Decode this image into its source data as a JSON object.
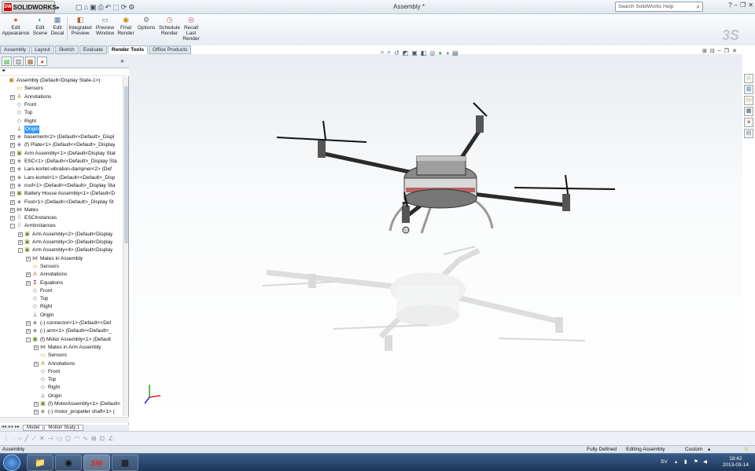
{
  "app": {
    "brand": "SOLIDWORKS",
    "document_title": "Assembly *",
    "search_placeholder": "Search SolidWorks Help"
  },
  "ribbon": {
    "buttons": [
      {
        "label": "Edit\nAppearance",
        "icon": "sphere-paint-icon"
      },
      {
        "label": "Edit\nScene",
        "icon": "scene-icon"
      },
      {
        "label": "Edit\nDecal",
        "icon": "decal-icon"
      },
      {
        "label": "Integrated\nPreview",
        "icon": "integrated-preview-icon"
      },
      {
        "label": "Preview\nWindow",
        "icon": "preview-window-icon"
      },
      {
        "label": "Final\nRender",
        "icon": "final-render-icon"
      },
      {
        "label": "Options",
        "icon": "options-icon"
      },
      {
        "label": "Schedule\nRender",
        "icon": "schedule-render-icon"
      },
      {
        "label": "Recall\nLast\nRender",
        "icon": "recall-render-icon"
      }
    ]
  },
  "tabs": [
    "Assembly",
    "Layout",
    "Sketch",
    "Evaluate",
    "Render Tools",
    "Office Products"
  ],
  "active_tab": "Render Tools",
  "tree": [
    {
      "label": "Assembly  (Default<Display State-1>)",
      "level": 0,
      "icon": "assembly-icon",
      "exp": ""
    },
    {
      "label": "Sensors",
      "level": 1,
      "icon": "folder-icon",
      "exp": ""
    },
    {
      "label": "Annotations",
      "level": 1,
      "icon": "annotation-icon",
      "exp": "+"
    },
    {
      "label": "Front",
      "level": 1,
      "icon": "plane-icon",
      "exp": ""
    },
    {
      "label": "Top",
      "level": 1,
      "icon": "plane-icon",
      "exp": ""
    },
    {
      "label": "Right",
      "level": 1,
      "icon": "plane-icon",
      "exp": ""
    },
    {
      "label": "Origin",
      "level": 1,
      "icon": "origin-icon",
      "exp": "",
      "selected": true
    },
    {
      "label": "basement<2> (Default<<Default>_Displ",
      "level": 1,
      "icon": "part-icon",
      "exp": "+"
    },
    {
      "label": "(f) Plate<1> (Default<<Default>_Display",
      "level": 1,
      "icon": "part-icon",
      "exp": "+"
    },
    {
      "label": "Arm Assembly<1> (Default<Display Stat",
      "level": 1,
      "icon": "subassembly-icon",
      "exp": "+"
    },
    {
      "label": "ESC<1> (Default<<Default>_Display Sta",
      "level": 1,
      "icon": "part-icon",
      "exp": "+"
    },
    {
      "label": "Lars-kortet-vibration-dampner<2> (Def",
      "level": 1,
      "icon": "part-icon",
      "exp": "+"
    },
    {
      "label": "Lars-kortet<1> (Default<<Default>_Disp",
      "level": 1,
      "icon": "part-icon",
      "exp": "+"
    },
    {
      "label": "roof<1> (Default<<Default>_Display Sta",
      "level": 1,
      "icon": "part-icon",
      "exp": "+"
    },
    {
      "label": "Battery House Assembly<1> (Default<D",
      "level": 1,
      "icon": "subassembly-icon",
      "exp": "+"
    },
    {
      "label": "Foot<1> (Default<<Default>_Display St",
      "level": 1,
      "icon": "part-icon",
      "exp": "+"
    },
    {
      "label": "Mates",
      "level": 1,
      "icon": "mates-icon",
      "exp": "+"
    },
    {
      "label": "ESCInstances",
      "level": 1,
      "icon": "pattern-icon",
      "exp": "+"
    },
    {
      "label": "ArmInstances",
      "level": 1,
      "icon": "pattern-icon",
      "exp": "-"
    },
    {
      "label": "Arm Assembly<2> (Default<Display",
      "level": 2,
      "icon": "subassembly-icon",
      "exp": "+"
    },
    {
      "label": "Arm Assembly<3> (Default<Display",
      "level": 2,
      "icon": "subassembly-icon",
      "exp": "+"
    },
    {
      "label": "Arm Assembly<4> (Default<Display",
      "level": 2,
      "icon": "subassembly-icon",
      "exp": "-"
    },
    {
      "label": "Mates in Assembly",
      "level": 3,
      "icon": "mates-icon",
      "exp": "+"
    },
    {
      "label": "Sensors",
      "level": 3,
      "icon": "folder-icon",
      "exp": ""
    },
    {
      "label": "Annotations",
      "level": 3,
      "icon": "annotation-icon",
      "exp": "+"
    },
    {
      "label": "Equations",
      "level": 3,
      "icon": "equations-icon",
      "exp": "+"
    },
    {
      "label": "Front",
      "level": 3,
      "icon": "plane-icon",
      "exp": ""
    },
    {
      "label": "Top",
      "level": 3,
      "icon": "plane-icon",
      "exp": ""
    },
    {
      "label": "Right",
      "level": 3,
      "icon": "plane-icon",
      "exp": ""
    },
    {
      "label": "Origin",
      "level": 3,
      "icon": "origin-icon",
      "exp": ""
    },
    {
      "label": "(-) connector<1> (Default<<Def",
      "level": 3,
      "icon": "part-icon",
      "exp": "+"
    },
    {
      "label": "(-) arm<1> (Default<<Default>_",
      "level": 3,
      "icon": "part-icon",
      "exp": "+"
    },
    {
      "label": "(f) Motor Assembly<1> (Default",
      "level": 3,
      "icon": "subassembly-icon",
      "exp": "-"
    },
    {
      "label": "Mates in Arm Assembly",
      "level": 4,
      "icon": "mates-icon",
      "exp": "+"
    },
    {
      "label": "Sensors",
      "level": 4,
      "icon": "folder-icon",
      "exp": ""
    },
    {
      "label": "Annotations",
      "level": 4,
      "icon": "annotation-icon",
      "exp": "+"
    },
    {
      "label": "Front",
      "level": 4,
      "icon": "plane-icon",
      "exp": ""
    },
    {
      "label": "Top",
      "level": 4,
      "icon": "plane-icon",
      "exp": ""
    },
    {
      "label": "Right",
      "level": 4,
      "icon": "plane-icon",
      "exp": ""
    },
    {
      "label": "Origin",
      "level": 4,
      "icon": "origin-icon",
      "exp": ""
    },
    {
      "label": "(f) MotorAssembly<1> (Default<",
      "level": 4,
      "icon": "subassembly-icon",
      "exp": "+"
    },
    {
      "label": "(-) motor_propeller shaft<1> (",
      "level": 4,
      "icon": "part-icon",
      "exp": "+"
    }
  ],
  "bottom_tabs": [
    "Model",
    "Motion Study 1"
  ],
  "status": {
    "left": "Assembly",
    "defined": "Fully Defined",
    "mode": "Editing Assembly",
    "units": "Custom"
  },
  "tray": {
    "lang": "SV",
    "time": "18:42",
    "date": "2013-03-14"
  },
  "colors": {
    "accent": "#3399ff",
    "brand_red": "#d40000"
  }
}
